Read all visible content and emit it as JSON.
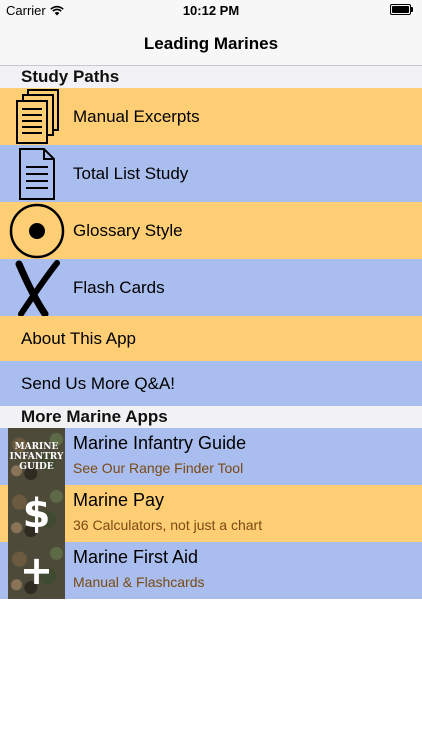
{
  "status_bar": {
    "carrier": "Carrier",
    "time": "10:12 PM",
    "battery_level": 1.0
  },
  "nav": {
    "title": "Leading Marines"
  },
  "sections": {
    "study_paths": "Study Paths",
    "more_apps": "More Marine Apps"
  },
  "study_rows": [
    {
      "label": "Manual Excerpts",
      "icon": "stacked-documents-icon",
      "color": "#fece74"
    },
    {
      "label": "Total List Study",
      "icon": "document-icon",
      "color": "#a9bdee"
    },
    {
      "label": "Glossary Style",
      "icon": "target-circle-icon",
      "color": "#fece74"
    },
    {
      "label": "Flash Cards",
      "icon": "x-mark-icon",
      "color": "#a9bdee"
    }
  ],
  "simple_rows": [
    {
      "label": "About This App",
      "color": "#fece74"
    },
    {
      "label": "Send Us More Q&A!",
      "color": "#a9bdee"
    }
  ],
  "apps": [
    {
      "title": "Marine Infantry Guide",
      "subtitle": "See Our Range Finder Tool",
      "icon_text": "MARINE INFANTRY GUIDE",
      "color": "#a9bdee"
    },
    {
      "title": "Marine Pay",
      "subtitle": "36 Calculators, not just a chart",
      "icon_glyph": "$",
      "color": "#fece74"
    },
    {
      "title": "Marine First Aid",
      "subtitle": "Manual & Flashcards",
      "icon_glyph": "+",
      "color": "#a9bdee"
    }
  ]
}
